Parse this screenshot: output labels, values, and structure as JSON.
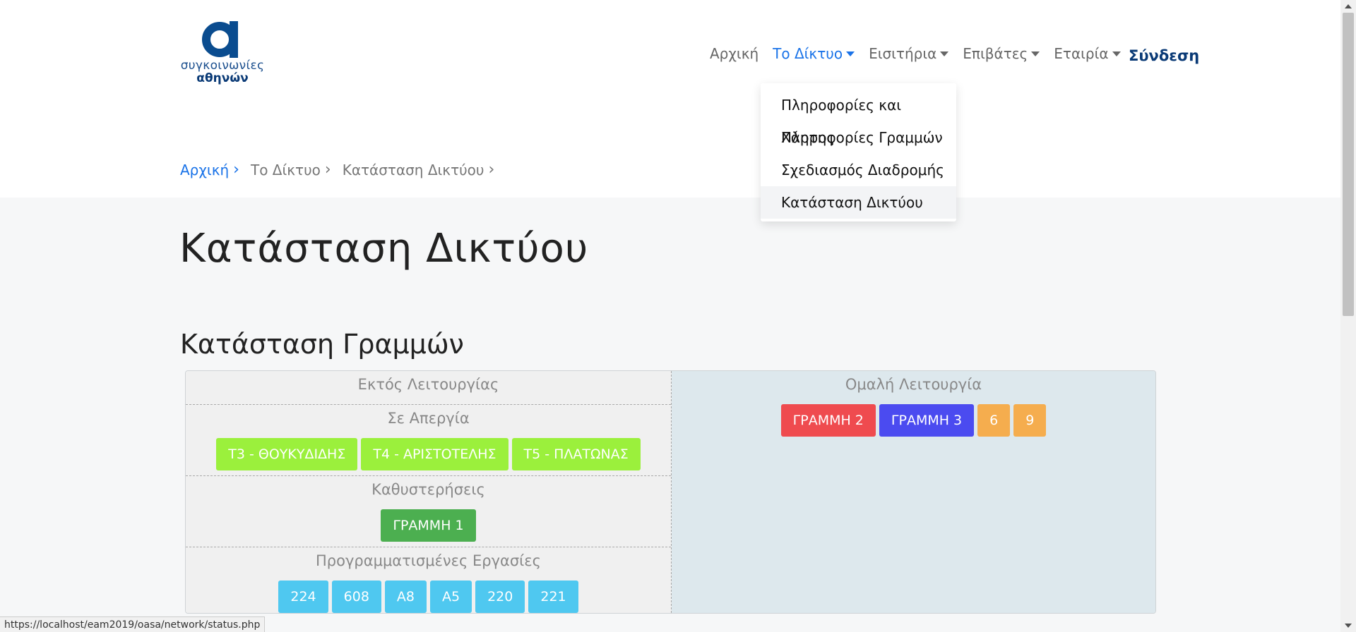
{
  "logo": {
    "line1": "συγκοινωνίες",
    "line2": "αθηνών",
    "color": "#0a4c8f"
  },
  "nav": {
    "items": [
      {
        "label": "Αρχική",
        "dropdown": false,
        "active": false
      },
      {
        "label": "Το Δίκτυο",
        "dropdown": true,
        "active": true
      },
      {
        "label": "Εισιτήρια",
        "dropdown": true,
        "active": false
      },
      {
        "label": "Επιβάτες",
        "dropdown": true,
        "active": false
      },
      {
        "label": "Εταιρία",
        "dropdown": true,
        "active": false
      }
    ],
    "login": "Σύνδεση"
  },
  "dropdown": {
    "items": [
      "Πληροφορίες και Χάρτης",
      "Πληροφορίες Γραμμών",
      "Σχεδιασμός Διαδρομής",
      "Κατάσταση Δικτύου"
    ],
    "highlighted_index": 3
  },
  "breadcrumb": [
    {
      "label": "Αρχική",
      "link": true
    },
    {
      "label": "Το Δίκτυο",
      "link": false
    },
    {
      "label": "Κατάσταση Δικτύου",
      "link": false
    }
  ],
  "page_title": "Κατάσταση Δικτύου",
  "section_title": "Κατάσταση Γραμμών",
  "status": {
    "left": [
      {
        "heading": "Εκτός Λειτουργίας",
        "lines": []
      },
      {
        "heading": "Σε Απεργία",
        "lines": [
          {
            "label": "Τ3 - ΘΟΥΚΥΔΙΔΗΣ",
            "color": "#9bf03c"
          },
          {
            "label": "Τ4 - ΑΡΙΣΤΟΤΕΛΗΣ",
            "color": "#9bf03c"
          },
          {
            "label": "Τ5 - ΠΛΑΤΩΝΑΣ",
            "color": "#9bf03c"
          }
        ]
      },
      {
        "heading": "Καθυστερήσεις",
        "lines": [
          {
            "label": "ΓΡΑΜΜΗ 1",
            "color": "#4caf50"
          }
        ]
      },
      {
        "heading": "Προγραμματισμένες Εργασίες",
        "lines": [
          {
            "label": "224",
            "color": "#4fc8f0"
          },
          {
            "label": "608",
            "color": "#4fc8f0"
          },
          {
            "label": "Α8",
            "color": "#4fc8f0"
          },
          {
            "label": "Α5",
            "color": "#4fc8f0"
          },
          {
            "label": "220",
            "color": "#4fc8f0"
          },
          {
            "label": "221",
            "color": "#4fc8f0"
          }
        ]
      }
    ],
    "right": [
      {
        "heading": "Ομαλή Λειτουργία",
        "lines": [
          {
            "label": "ΓΡΑΜΜΗ 2",
            "color": "#ef4b4f"
          },
          {
            "label": "ΓΡΑΜΜΗ 3",
            "color": "#4b4bf0"
          },
          {
            "label": "6",
            "color": "#f5ad4e"
          },
          {
            "label": "9",
            "color": "#f5ad4e"
          }
        ]
      }
    ]
  },
  "status_bar_url": "https://localhost/eam2019/oasa/network/status.php"
}
